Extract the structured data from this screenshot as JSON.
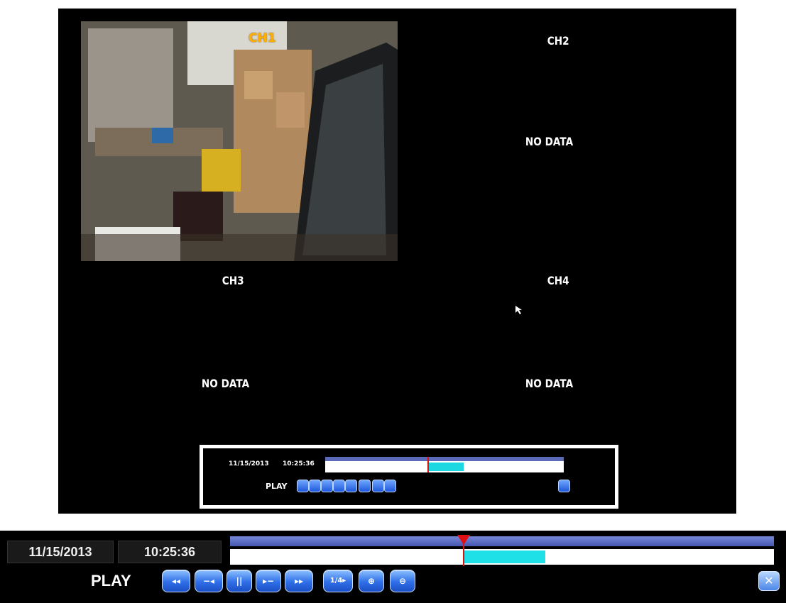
{
  "screen": {
    "channels": [
      {
        "label": "CH1"
      },
      {
        "label": "CH2",
        "status": "NO DATA"
      },
      {
        "label": "CH3",
        "status": "NO DATA"
      },
      {
        "label": "CH4",
        "status": "NO DATA"
      }
    ]
  },
  "mini_panel": {
    "date": "11/15/2013",
    "time": "10:25:36",
    "mode": "PLAY"
  },
  "control_bar": {
    "date": "11/15/2013",
    "time": "10:25:36",
    "mode": "PLAY",
    "buttons": [
      {
        "icon": "fast-rewind-icon",
        "glyph": "◂◂"
      },
      {
        "icon": "step-back-icon",
        "glyph": "−◂"
      },
      {
        "icon": "pause-icon",
        "glyph": "||"
      },
      {
        "icon": "step-forward-icon",
        "glyph": "▸−"
      },
      {
        "icon": "fast-forward-icon",
        "glyph": "▸▸"
      },
      {
        "icon": "speed-icon",
        "glyph": "1/4▸"
      },
      {
        "icon": "zoom-in-icon",
        "glyph": "⊕"
      },
      {
        "icon": "zoom-out-icon",
        "glyph": "⊖"
      }
    ],
    "close_glyph": "✕"
  },
  "timeline": {
    "playhead_fraction": 0.43,
    "recorded_segment": {
      "start_fraction": 0.43,
      "end_fraction": 0.58
    }
  },
  "colors": {
    "accent_blue": "#2f6fe8",
    "recorded_cyan": "#1ee0e6",
    "playhead_red": "#e01010",
    "ch1_label": "#ffb000"
  }
}
